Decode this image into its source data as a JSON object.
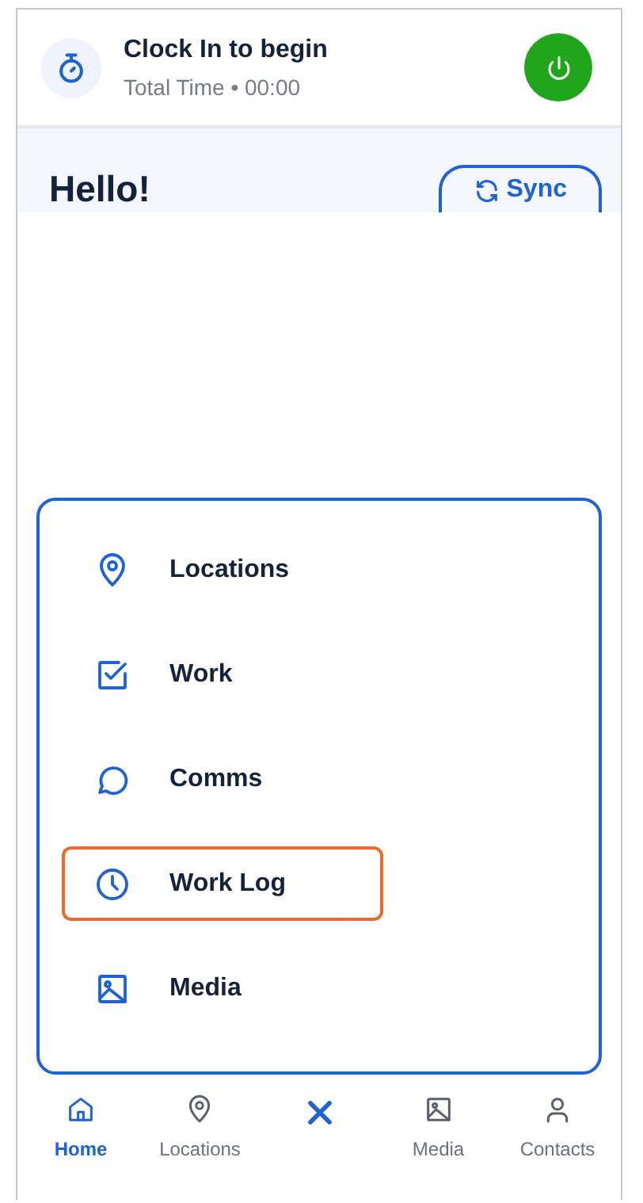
{
  "header": {
    "title": "Clock In to begin",
    "subtitle": "Total Time • 00:00"
  },
  "greeting": "Hello!",
  "sync_button": "Sync",
  "menu": [
    {
      "kind": "location",
      "label": "Locations",
      "selected": false
    },
    {
      "kind": "check",
      "label": "Work",
      "selected": false
    },
    {
      "kind": "chat",
      "label": "Comms",
      "selected": false
    },
    {
      "kind": "clock",
      "label": "Work Log",
      "selected": true
    },
    {
      "kind": "image",
      "label": "Media",
      "selected": false
    }
  ],
  "nav": [
    {
      "kind": "home",
      "label": "Home",
      "selected": true
    },
    {
      "kind": "location",
      "label": "Locations",
      "selected": false
    },
    {
      "kind": "close"
    },
    {
      "kind": "image",
      "label": "Media",
      "selected": false
    },
    {
      "kind": "person",
      "label": "Contacts",
      "selected": false
    }
  ]
}
